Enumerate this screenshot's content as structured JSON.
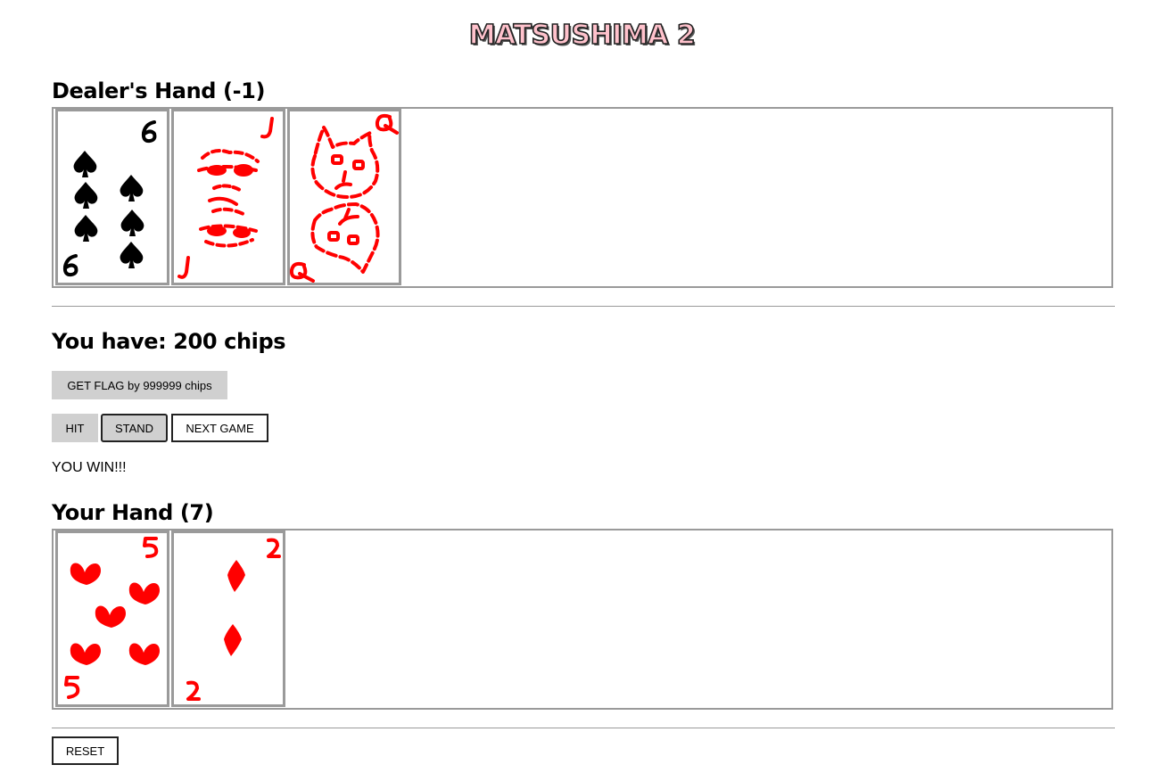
{
  "title": "MATSUSHIMA 2",
  "dealer": {
    "heading": "Dealer's Hand (-1)",
    "cards": [
      {
        "rank": "6",
        "suit": "spades",
        "color": "#000000"
      },
      {
        "rank": "J",
        "suit": "face-jack",
        "color": "#ff0000"
      },
      {
        "rank": "Q",
        "suit": "face-queen",
        "color": "#ff0000"
      }
    ]
  },
  "chips": {
    "text": "You have: 200 chips"
  },
  "buttons": {
    "get_flag": "GET FLAG by 999999 chips",
    "hit": "HIT",
    "stand": "STAND",
    "next_game": "NEXT GAME",
    "reset": "RESET"
  },
  "status": "YOU WIN!!!",
  "player": {
    "heading": "Your Hand (7)",
    "cards": [
      {
        "rank": "5",
        "suit": "hearts",
        "color": "#ff0000"
      },
      {
        "rank": "2",
        "suit": "diamonds",
        "color": "#ff0000"
      }
    ]
  },
  "colors": {
    "card_red": "#ff0000",
    "card_black": "#000000",
    "title_fill": "#ffc2cc",
    "border_gray": "#9a9a9a"
  }
}
